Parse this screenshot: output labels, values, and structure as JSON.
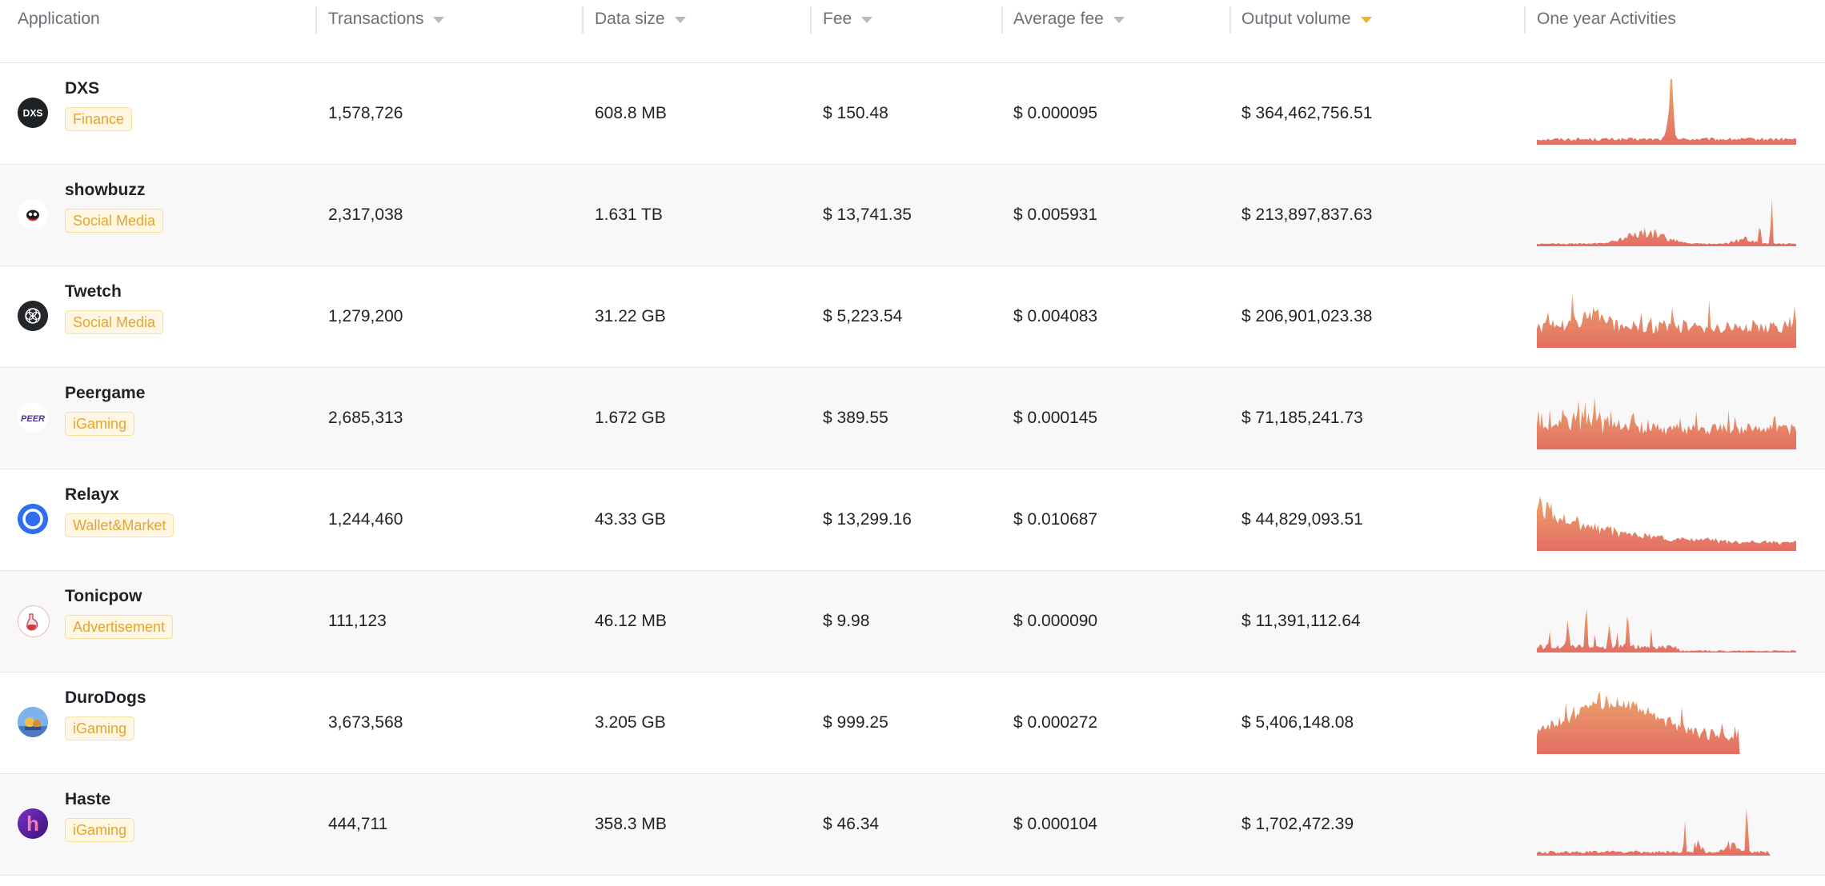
{
  "colors": {
    "tag_text": "#e5a52b",
    "tag_bg": "#fff6e3",
    "tag_border": "#f7df9d",
    "sort_active": "#f0b323",
    "spark_top": "#eba46a",
    "spark_bottom": "#e36e63"
  },
  "header": {
    "columns": [
      {
        "label": "Application",
        "sortable": false
      },
      {
        "label": "Transactions",
        "sortable": true
      },
      {
        "label": "Data size",
        "sortable": true
      },
      {
        "label": "Fee",
        "sortable": true
      },
      {
        "label": "Average fee",
        "sortable": true
      },
      {
        "label": "Output volume",
        "sortable": true,
        "active": true
      },
      {
        "label": "One year Activities",
        "sortable": false
      }
    ]
  },
  "rows": [
    {
      "name": "DXS",
      "tag": "Finance",
      "logo_icon": "dxs-logo-icon",
      "logo_text": "DXS",
      "transactions": "1,578,726",
      "data_size": "608.8 MB",
      "fee": "$ 150.48",
      "avg_fee": "$ 0.000095",
      "output_volume": "$ 364,462,756.51"
    },
    {
      "name": "showbuzz",
      "tag": "Social Media",
      "logo_icon": "showbuzz-logo-icon",
      "logo_text": "",
      "transactions": "2,317,038",
      "data_size": "1.631 TB",
      "fee": "$ 13,741.35",
      "avg_fee": "$ 0.005931",
      "output_volume": "$ 213,897,837.63"
    },
    {
      "name": "Twetch",
      "tag": "Social Media",
      "logo_icon": "twetch-logo-icon",
      "logo_text": "",
      "transactions": "1,279,200",
      "data_size": "31.22 GB",
      "fee": "$ 5,223.54",
      "avg_fee": "$ 0.004083",
      "output_volume": "$ 206,901,023.38"
    },
    {
      "name": "Peergame",
      "tag": "iGaming",
      "logo_icon": "peergame-logo-icon",
      "logo_text": "PEER",
      "transactions": "2,685,313",
      "data_size": "1.672 GB",
      "fee": "$ 389.55",
      "avg_fee": "$ 0.000145",
      "output_volume": "$ 71,185,241.73"
    },
    {
      "name": "Relayx",
      "tag": "Wallet&Market",
      "logo_icon": "relayx-logo-icon",
      "logo_text": "",
      "transactions": "1,244,460",
      "data_size": "43.33 GB",
      "fee": "$ 13,299.16",
      "avg_fee": "$ 0.010687",
      "output_volume": "$ 44,829,093.51"
    },
    {
      "name": "Tonicpow",
      "tag": "Advertisement",
      "logo_icon": "tonicpow-logo-icon",
      "logo_text": "",
      "transactions": "111,123",
      "data_size": "46.12 MB",
      "fee": "$ 9.98",
      "avg_fee": "$ 0.000090",
      "output_volume": "$ 11,391,112.64"
    },
    {
      "name": "DuroDogs",
      "tag": "iGaming",
      "logo_icon": "durodogs-logo-icon",
      "logo_text": "",
      "transactions": "3,673,568",
      "data_size": "3.205 GB",
      "fee": "$ 999.25",
      "avg_fee": "$ 0.000272",
      "output_volume": "$ 5,406,148.08"
    },
    {
      "name": "Haste",
      "tag": "iGaming",
      "logo_icon": "haste-logo-icon",
      "logo_text": "h",
      "transactions": "444,711",
      "data_size": "358.3 MB",
      "fee": "$ 46.34",
      "avg_fee": "$ 0.000104",
      "output_volume": "$ 1,702,472.39"
    }
  ],
  "sparklines": [
    {
      "profile": "baseline-low, single tall spike near 52%",
      "peak_at": 0.52,
      "coverage": 1.0
    },
    {
      "profile": "mostly flat, middle hump, narrow spikes near 86% and 90%",
      "peak_at": 0.9,
      "coverage": 1.0
    },
    {
      "profile": "dense high-activity throughout with many spikes",
      "peak_at": 0.22,
      "coverage": 1.0
    },
    {
      "profile": "dense, elevated early portion then moderate",
      "peak_at": 0.2,
      "coverage": 1.0
    },
    {
      "profile": "high at start, gradually decaying",
      "peak_at": 0.03,
      "coverage": 1.0
    },
    {
      "profile": "spiky bursts in first half, near zero later",
      "peak_at": 0.19,
      "coverage": 1.0
    },
    {
      "profile": "broad mound, peak around 24%, ends at 78%",
      "peak_at": 0.24,
      "coverage": 0.78
    },
    {
      "profile": "flat, late spikes near 57% and 81%",
      "peak_at": 0.81,
      "coverage": 0.9
    }
  ]
}
